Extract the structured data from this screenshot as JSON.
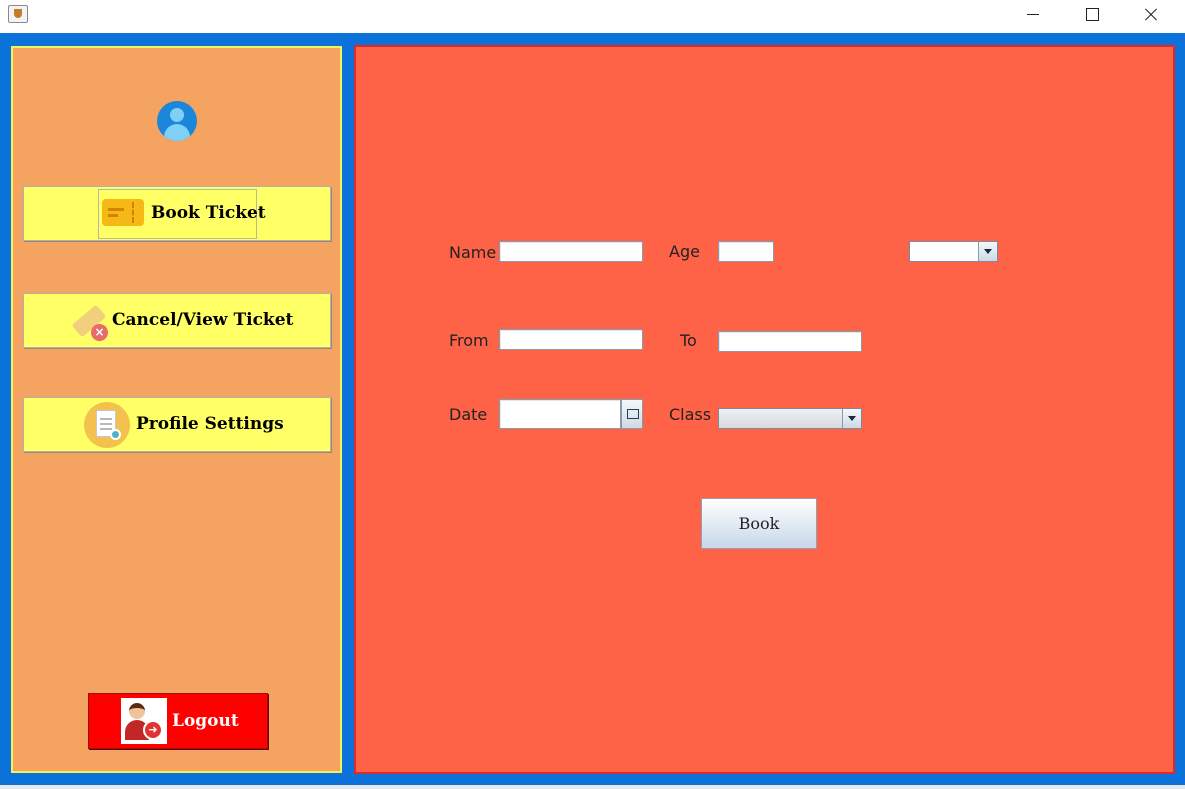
{
  "window": {
    "app_icon": "java-cup-icon",
    "controls": [
      "minimize-icon",
      "maximize-icon",
      "close-icon"
    ]
  },
  "sidebar": {
    "avatar_icon": "user-avatar-icon",
    "buttons": [
      {
        "label": "Book Ticket",
        "icon": "ticket-icon"
      },
      {
        "label": "Cancel/View Ticket",
        "icon": "ticket-cancel-icon"
      },
      {
        "label": "Profile Settings",
        "icon": "profile-document-icon"
      }
    ],
    "logout": {
      "label": "Logout",
      "icon": "logout-user-icon"
    }
  },
  "form": {
    "name_label": "Name",
    "age_label": "Age",
    "from_label": "From",
    "to_label": "To",
    "date_label": "Date",
    "class_label": "Class",
    "name_value": "",
    "age_value": "",
    "from_value": "",
    "to_value": "",
    "date_value": "",
    "gender_selected": "",
    "class_selected": "",
    "date_picker_icon": "calendar-icon",
    "book_label": "Book"
  },
  "colors": {
    "frame": "#0a72d8",
    "sidebar": "#f4a460",
    "main_panel": "#ff6347",
    "nav_button": "#ffff66",
    "logout_button": "#ff0000"
  }
}
